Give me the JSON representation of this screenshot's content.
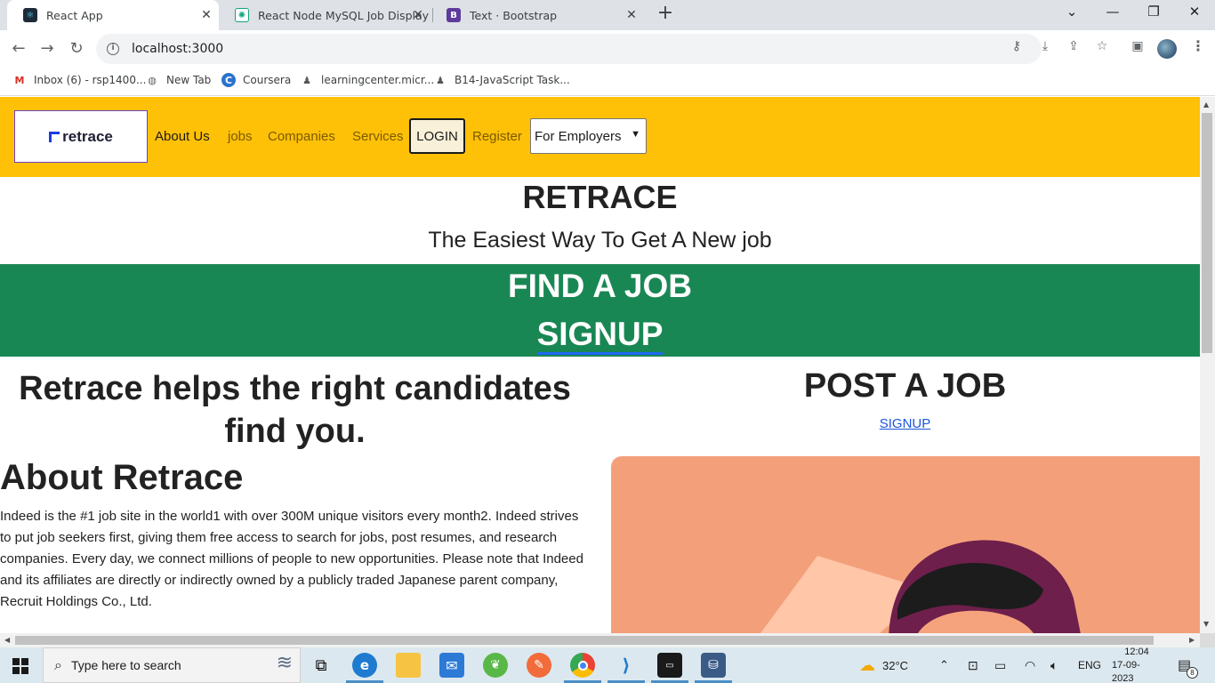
{
  "browser": {
    "tabs": [
      {
        "title": "React App",
        "active": true
      },
      {
        "title": "React Node MySQL Job Display",
        "active": false
      },
      {
        "title": "Text · Bootstrap",
        "active": false
      }
    ],
    "url": "localhost:3000",
    "bookmarks": [
      {
        "label": "Inbox (6) - rsp1400...",
        "icon": "gmail-icon"
      },
      {
        "label": "New Tab",
        "icon": "globe-icon"
      },
      {
        "label": "Coursera",
        "icon": "coursera-icon"
      },
      {
        "label": "learningcenter.micr...",
        "icon": "person-icon"
      },
      {
        "label": "B14-JavaScript Task...",
        "icon": "person-icon"
      }
    ]
  },
  "navbar": {
    "logo_text": "retrace",
    "links": [
      "About Us",
      "jobs",
      "Companies",
      "Services"
    ],
    "login_label": "LOGIN",
    "register_label": "Register",
    "select_value": "For Employers"
  },
  "hero": {
    "title": "RETRACE",
    "subtitle": "The Easiest Way To Get A New job",
    "find_job": "FIND A JOB",
    "signup": "SIGNUP"
  },
  "left": {
    "tagline": "Retrace helps the right candidates find you.",
    "about_heading": "About Retrace",
    "about_text": "Indeed is the #1 job site in the world1 with over 300M unique visitors every month2. Indeed strives to put job seekers first, giving them free access to search for jobs, post resumes, and research companies. Every day, we connect millions of people to new opportunities. Please note that Indeed and its affiliates are directly or indirectly owned by a publicly traded Japanese parent company, Recruit Holdings Co., Ltd."
  },
  "right": {
    "heading": "POST A JOB",
    "signup_link": "SIGNUP"
  },
  "taskbar": {
    "search_placeholder": "Type here to search",
    "weather": "32°C",
    "language": "ENG",
    "time": "12:04",
    "date": "17-09-2023",
    "notifications": "8"
  },
  "colors": {
    "navbar_bg": "#ffc107",
    "band_bg": "#198754",
    "illustration_bg": "#f3a07a"
  }
}
